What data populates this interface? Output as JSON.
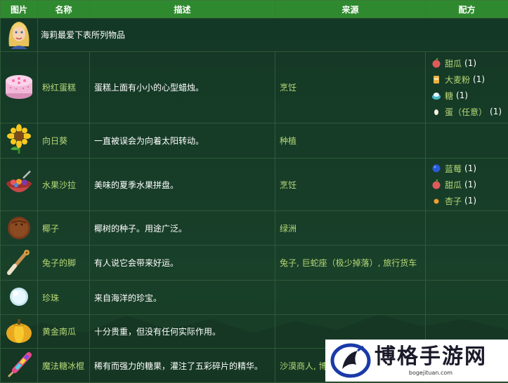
{
  "header": {
    "col_image": "图片",
    "col_name": "名称",
    "col_desc": "描述",
    "col_source": "来源",
    "col_recipe": "配方"
  },
  "intro_text": "海莉最爱下表所列物品",
  "rows": [
    {
      "name": "粉红蛋糕",
      "desc": "蛋糕上面有小小的心型蜡烛。",
      "source": "烹饪",
      "icon": "pink-cake-icon",
      "recipe": [
        {
          "name": "甜瓜",
          "qty": "(1)",
          "icon": "melon-icon"
        },
        {
          "name": "大麦粉",
          "qty": "(1)",
          "icon": "wheat-flour-icon"
        },
        {
          "name": "糖",
          "qty": "(1)",
          "icon": "sugar-icon"
        },
        {
          "name": "蛋（任意）",
          "qty": "(1)",
          "icon": "egg-icon"
        }
      ]
    },
    {
      "name": "向日葵",
      "desc": "一直被误会为向着太阳转动。",
      "source": "种植",
      "icon": "sunflower-icon",
      "recipe": []
    },
    {
      "name": "水果沙拉",
      "desc": "美味的夏季水果拼盘。",
      "source": "烹饪",
      "icon": "fruit-salad-icon",
      "recipe": [
        {
          "name": "蓝莓",
          "qty": "(1)",
          "icon": "blueberry-icon"
        },
        {
          "name": "甜瓜",
          "qty": "(1)",
          "icon": "melon-icon"
        },
        {
          "name": "杏子",
          "qty": "(1)",
          "icon": "apricot-icon"
        }
      ]
    },
    {
      "name": "椰子",
      "desc": "椰树的种子。用途广泛。",
      "source": "绿洲",
      "icon": "coconut-icon",
      "recipe": []
    },
    {
      "name": "兔子的脚",
      "desc": "有人说它会带来好运。",
      "source": "兔子, 巨蛇座（极少掉落）, 旅行货车",
      "icon": "rabbit-foot-icon",
      "recipe": []
    },
    {
      "name": "珍珠",
      "desc": "来自海洋的珍宝。",
      "source": "",
      "icon": "pearl-icon",
      "recipe": []
    },
    {
      "name": "黄金南瓜",
      "desc": "十分贵重，但没有任何实际作用。",
      "source": "",
      "icon": "golden-pumpkin-icon",
      "recipe": []
    },
    {
      "name": "魔法糖冰棍",
      "desc": "稀有而强力的糖果，灌注了五彩碎片的精华。",
      "source": "沙漠商人, 博",
      "icon": "magic-rock-candy-icon",
      "recipe": []
    }
  ],
  "watermark": {
    "title": "博格手游网",
    "url": "bogejituan.com"
  },
  "colors": {
    "header_bg": "#2f8a2f",
    "link_text": "#b7d977",
    "page_bg": "#1f4a1f"
  }
}
